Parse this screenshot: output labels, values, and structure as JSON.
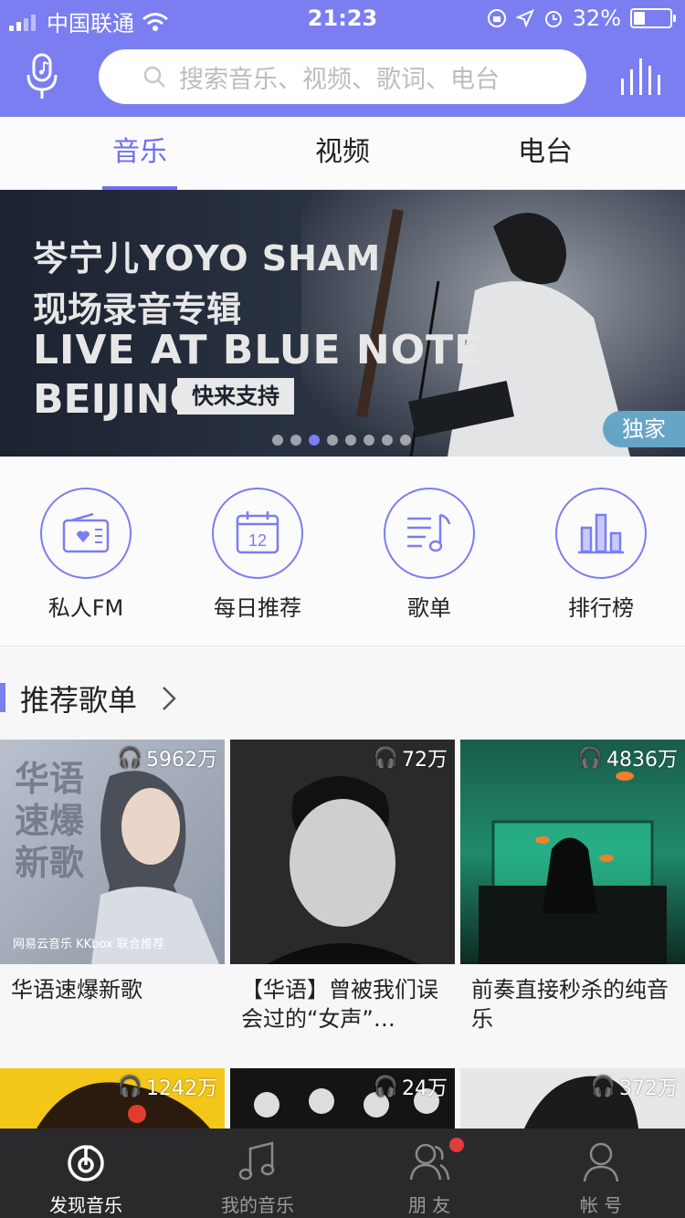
{
  "status_bar": {
    "carrier": "中国联通",
    "time": "21:23",
    "battery": "32%",
    "battery_fraction": 0.32
  },
  "search": {
    "placeholder": "搜索音乐、视频、歌词、电台"
  },
  "tabs": [
    {
      "label": "音乐",
      "active": true
    },
    {
      "label": "视频",
      "active": false
    },
    {
      "label": "电台",
      "active": false
    }
  ],
  "banner": {
    "line1": "岑宁儿YOYO SHAM",
    "line2": "现场录音专辑",
    "line3": "LIVE AT BLUE NOTE",
    "line4": "BEIJING",
    "button": "快来支持",
    "tag": "独家",
    "dots": {
      "count": 8,
      "active": 2
    }
  },
  "entries": [
    {
      "label": "私人FM",
      "icon": "radio-icon"
    },
    {
      "label": "每日推荐",
      "icon": "calendar-icon",
      "day": "12"
    },
    {
      "label": "歌单",
      "icon": "playlist-icon"
    },
    {
      "label": "排行榜",
      "icon": "chart-icon"
    }
  ],
  "section": {
    "title": "推荐歌单"
  },
  "playlists": [
    {
      "count": "5962万",
      "title": "华语速爆新歌",
      "cover_text": "华语\n速爆\n新歌",
      "cover_footer": "网易云音乐 KKbox 联合推荐"
    },
    {
      "count": "72万",
      "title": "【华语】曾被我们误会过的“女声”…"
    },
    {
      "count": "4836万",
      "title": "前奏直接秒杀的纯音乐"
    },
    {
      "count": "1242万"
    },
    {
      "count": "24万"
    },
    {
      "count": "372万"
    }
  ],
  "bottom_nav": [
    {
      "label": "发现音乐",
      "active": true
    },
    {
      "label": "我的音乐",
      "active": false
    },
    {
      "label": "朋 友",
      "active": false
    },
    {
      "label": "帐 号",
      "active": false
    }
  ],
  "colors": {
    "accent": "#7b7ef0",
    "nav_bg": "#2a2a2c",
    "badge": "#e23c3c"
  }
}
